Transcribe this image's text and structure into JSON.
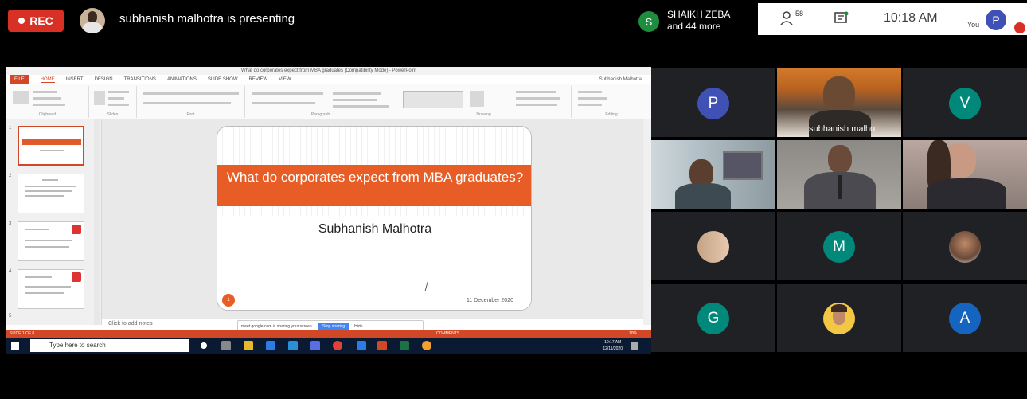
{
  "topbar": {
    "rec_label": "REC",
    "presenting_text": "subhanish malhotra is presenting",
    "other_initial": "S",
    "other_name": "SHAIKH ZEBA",
    "other_more": "and 44 more",
    "participant_count": "58",
    "time": "10:18 AM",
    "you_label": "You",
    "you_initial": "P"
  },
  "powerpoint": {
    "window_title": "What do corporates expect from MBA graduates [Compatibility Mode] - PowerPoint",
    "tabs": [
      "FILE",
      "HOME",
      "INSERT",
      "DESIGN",
      "TRANSITIONS",
      "ANIMATIONS",
      "SLIDE SHOW",
      "REVIEW",
      "VIEW"
    ],
    "user": "Subhanish Malhotra",
    "ribbon_groups": [
      "Clipboard",
      "Slides",
      "Font",
      "Paragraph",
      "Drawing",
      "Editing"
    ],
    "slide_numbers": [
      "1",
      "2",
      "3",
      "4",
      "5"
    ],
    "slide": {
      "title": "What do corporates expect from MBA graduates?",
      "author": "Subhanish Malhotra",
      "date": "11 December 2020"
    },
    "notes_placeholder": "Click to add notes",
    "share_banner_text": "meet.google.com is sharing your screen.",
    "stop_sharing": "Stop sharing",
    "hide": "Hide",
    "status_left": "SLIDE 1 OF 8",
    "status_comments": "COMMENTS",
    "zoom": "70%"
  },
  "taskbar": {
    "search_placeholder": "Type here to search",
    "clock_time": "10:17 AM",
    "clock_date": "12/11/2020"
  },
  "participants": {
    "tile_1_initial": "P",
    "tile_2_name": "subhanish malho",
    "tile_3_initial": "V",
    "tile_8_initial": "M",
    "tile_10_initial": "G",
    "tile_12_initial": "A"
  },
  "colors": {
    "accent_orange": "#e85d26",
    "rec_red": "#d93025",
    "tile_bg": "#202124"
  }
}
